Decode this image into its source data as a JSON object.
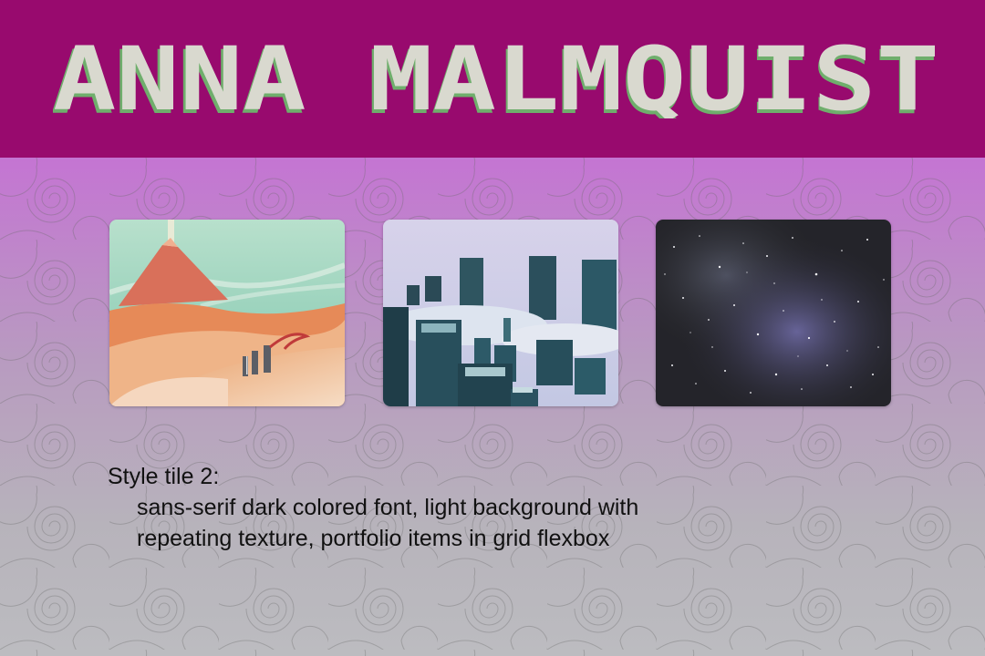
{
  "header": {
    "title": "ANNA MALMQUIST",
    "background_color": "#980a6e",
    "text_color": "#d9d9cf",
    "shadow_color": "#6fae6c"
  },
  "gallery": {
    "items": [
      {
        "name": "desert-mountain-painting",
        "subject": "red mountain with light beam over desert dunes and standing stones"
      },
      {
        "name": "city-towers-painting",
        "subject": "teal skyscrapers rising above clouds"
      },
      {
        "name": "starry-nebula-painting",
        "subject": "dark night sky with stars and purple nebula"
      }
    ]
  },
  "caption": {
    "heading": "Style tile 2:",
    "body_line1": "sans-serif dark colored font, light background with",
    "body_line2": "repeating texture, portfolio items in grid flexbox"
  },
  "colors": {
    "page_gradient_top": "#cc66dd",
    "page_gradient_bottom": "#bcbcc0",
    "caption_text": "#111111"
  }
}
